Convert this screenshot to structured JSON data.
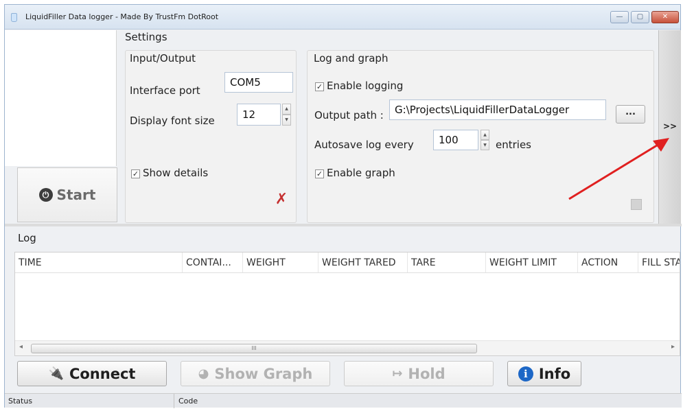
{
  "window": {
    "title": "LiquidFiller Data logger - Made By TrustFm DotRoot",
    "minimize_glyph": "—",
    "maximize_glyph": "▢",
    "close_glyph": "✕"
  },
  "start_button": {
    "label": "Start",
    "icon": "power-icon"
  },
  "settings": {
    "label": "Settings",
    "input_output": {
      "label": "Input/Output",
      "interface_port_label": "Interface port",
      "interface_port_value": "COM5",
      "display_font_size_label": "Display font size",
      "display_font_size_value": "12",
      "show_details_label": "Show details",
      "show_details_checked": true
    },
    "log_and_graph": {
      "label": "Log and graph",
      "enable_logging_label": "Enable logging",
      "enable_logging_checked": true,
      "output_path_label": "Output path :",
      "output_path_value": "G:\\Projects\\LiquidFillerDataLogger",
      "browse_label": "...",
      "autosave_label": "Autosave log every",
      "autosave_value": "100",
      "entries_label": "entries",
      "enable_graph_label": "Enable graph",
      "enable_graph_checked": true
    }
  },
  "expand_button": {
    "label": ">>"
  },
  "log": {
    "label": "Log",
    "columns": [
      "TIME",
      "CONTAI...",
      "WEIGHT",
      "WEIGHT TARED",
      "TARE",
      "WEIGHT LIMIT",
      "ACTION",
      "FILL STA"
    ],
    "scroll_thumb": "III",
    "scroll_left": "◂",
    "scroll_right": "▸"
  },
  "buttons": {
    "connect": "Connect",
    "show_graph": "Show Graph",
    "hold": "Hold",
    "info": "Info"
  },
  "statusbar": {
    "status": "Status",
    "code": "Code"
  },
  "colors": {
    "annotation_arrow": "#e02020",
    "info_icon": "#1d67c6"
  }
}
